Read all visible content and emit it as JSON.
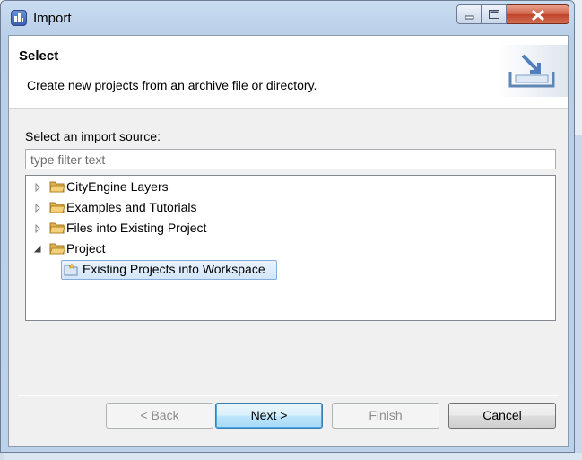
{
  "window": {
    "title": "Import",
    "icon": "cityengine-app-icon",
    "controls": [
      "minimize-icon",
      "maximize-icon",
      "close-icon"
    ]
  },
  "header": {
    "title": "Select",
    "description": "Create new projects from an archive file or directory.",
    "icon": "import-tray-icon"
  },
  "source_label": "Select an import source:",
  "filter": {
    "value": "",
    "placeholder": "type filter text"
  },
  "tree": {
    "nodes": [
      {
        "label": "CityEngine Layers",
        "expanded": false,
        "icon": "folder-icon"
      },
      {
        "label": "Examples and Tutorials",
        "expanded": false,
        "icon": "folder-icon"
      },
      {
        "label": "Files into Existing Project",
        "expanded": false,
        "icon": "folder-icon"
      },
      {
        "label": "Project",
        "expanded": true,
        "icon": "folder-open-icon",
        "children": [
          {
            "label": "Existing Projects into Workspace",
            "selected": true,
            "icon": "project-icon"
          }
        ]
      }
    ]
  },
  "buttons": {
    "back": "< Back",
    "next": "Next >",
    "finish": "Finish",
    "cancel": "Cancel"
  },
  "colors": {
    "selection_fill": "#d9e8fb",
    "selection_border": "#84acdd",
    "default_button_border": "#3c7fb1",
    "folder": "#e8b84a"
  }
}
